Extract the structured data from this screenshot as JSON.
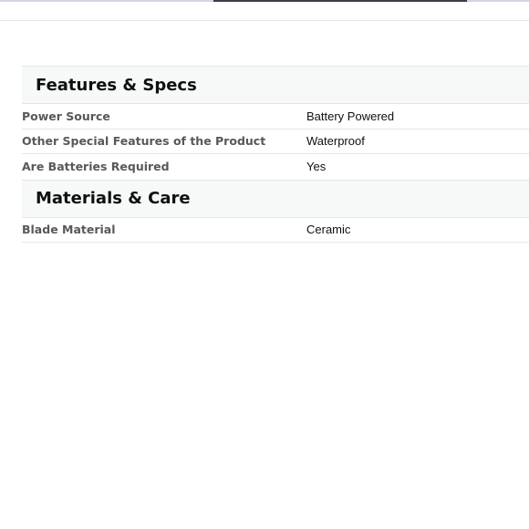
{
  "sections": [
    {
      "title": "Features & Specs",
      "rows": [
        {
          "label": "Power Source",
          "value": "Battery Powered"
        },
        {
          "label": "Other Special Features of the Product",
          "value": "Waterproof"
        },
        {
          "label": "Are Batteries Required",
          "value": "Yes"
        }
      ]
    },
    {
      "title": "Materials & Care",
      "rows": [
        {
          "label": "Blade Material",
          "value": "Ceramic"
        }
      ]
    }
  ],
  "colors": {
    "header_bg": "#f7f8f8",
    "divider": "#e3e6e6",
    "label_text": "#565959",
    "value_text": "#0f1111"
  }
}
